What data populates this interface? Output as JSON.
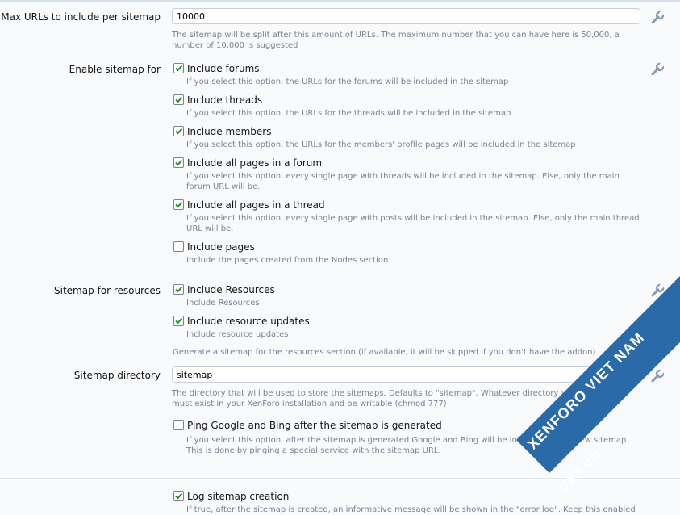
{
  "max_urls": {
    "label": "Max URLs to include per sitemap",
    "value": "10000",
    "hint": "The sitemap will be split after this amount of URLs. The maximum number that you can have here is 50,000, a number of 10,000 is suggested"
  },
  "enable_sitemap": {
    "label": "Enable sitemap for",
    "options": [
      {
        "label": "Include forums",
        "hint": "If you select this option, the URLs for the forums will be included in the sitemap",
        "checked": true
      },
      {
        "label": "Include threads",
        "hint": "If you select this option, the URLs for the threads will be included in the sitemap",
        "checked": true
      },
      {
        "label": "Include members",
        "hint": "If you select this option, the URLs for the members' profile pages will be included in the sitemap",
        "checked": true
      },
      {
        "label": "Include all pages in a forum",
        "hint1": "If you select this option, every single page with threads will be included in the sitemap. Else, only the main",
        "hint2": "forum URL will be.",
        "checked": true
      },
      {
        "label": "Include all pages in a thread",
        "hint1": "If you select this option, every single page with posts will be included in the sitemap. Else, only the main thread",
        "hint2": "URL will be.",
        "checked": true
      },
      {
        "label": "Include pages",
        "hint": "Include the pages created from the Nodes section",
        "checked": false
      }
    ]
  },
  "resources": {
    "label": "Sitemap for resources",
    "options": [
      {
        "label": "Include Resources",
        "hint": "Include Resources",
        "checked": true
      },
      {
        "label": "Include resource updates",
        "hint": "Include resource updates",
        "checked": true
      }
    ],
    "hint": "Generate a sitemap for the resources section (if available, it will be skipped if you don't have the addon)"
  },
  "directory": {
    "label": "Sitemap directory",
    "value": "sitemap",
    "hint1": "The directory that will be used to store the sitemaps. Defaults to \"sitemap\". Whatever directory you put here,",
    "hint2": "must exist in your XenForo installation and be writable (chmod 777)"
  },
  "ping": {
    "label": "Ping Google and Bing after the sitemap is generated",
    "hint1": "If you select this option, after the sitemap is generated Google and Bing will be informed of the new sitemap.",
    "hint2": "This is done by pinging a special service with the sitemap URL.",
    "checked": false
  },
  "log": {
    "label": "Log sitemap creation",
    "hint": "If true, after the sitemap is created, an informative message will be shown in the \"error log\". Keep this enabled",
    "checked": true
  },
  "watermark": {
    "text": "XENFORO VIET NAM",
    "url": "VXF.VN",
    "color": "#2a6aa8"
  },
  "icons": {
    "wrench": "wrench-icon",
    "check": "checkmark-icon"
  }
}
